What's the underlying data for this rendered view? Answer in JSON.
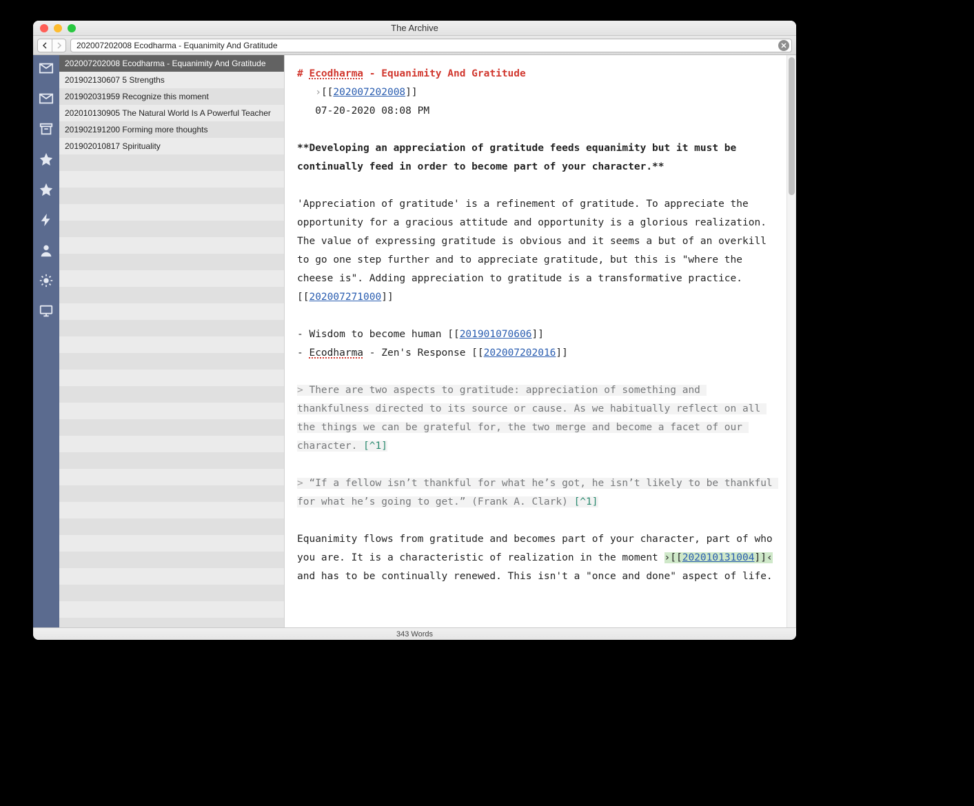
{
  "window": {
    "title": "The Archive"
  },
  "toolbar": {
    "search_value": "202007202008 Ecodharma - Equanimity And Gratitude"
  },
  "sidebar_icons": [
    {
      "name": "envelope-icon"
    },
    {
      "name": "envelope-icon"
    },
    {
      "name": "archive-box-icon"
    },
    {
      "name": "star-icon"
    },
    {
      "name": "star-icon"
    },
    {
      "name": "bolt-icon"
    },
    {
      "name": "user-icon"
    },
    {
      "name": "brightness-icon"
    },
    {
      "name": "monitor-icon"
    }
  ],
  "notes": [
    {
      "label": "202007202008 Ecodharma - Equanimity And Gratitude",
      "selected": true
    },
    {
      "label": "201902130607 5 Strengths"
    },
    {
      "label": "201902031959 Recognize this moment"
    },
    {
      "label": "202010130905 The Natural World Is A Powerful Teacher"
    },
    {
      "label": "201902191200 Forming more thoughts"
    },
    {
      "label": "201902010817 Spirituality"
    }
  ],
  "editor": {
    "hash": "#",
    "title_spell": "Ecodharma",
    "title_rest": " - Equanimity And Gratitude",
    "meta_marker": "›",
    "meta_br1": "[[",
    "meta_link": "202007202008",
    "meta_br2": "]]",
    "meta_date": "07-20-2020 08:08 PM",
    "summary": "**Developing an appreciation of gratitude feeds equanimity but it must be continually feed in order to become part of your character.**",
    "para1_a": "'Appreciation of gratitude' is a refinement of gratitude. To appreciate the opportunity for a gracious attitude and opportunity is a glorious realization. The value of expressing gratitude is obvious and it seems a but of an overkill to go one step further and to appreciate gratitude, but this is \"where the cheese is\". Adding appreciation to gratitude is a transformative practice. [[",
    "para1_link": "202007271000",
    "para1_b": "]]",
    "bullet1_a": "- Wisdom to become human [[",
    "bullet1_link": "201901070606",
    "bullet1_b": "]]",
    "bullet2_a": "- ",
    "bullet2_spell": "Ecodharma",
    "bullet2_mid": " - Zen's Response [[",
    "bullet2_link": "202007202016",
    "bullet2_b": "]]",
    "q1_marker": "> ",
    "q1_text": "There are two aspects to gratitude: appreciation of something and thankfulness directed to its source or cause. As we habitually reflect on all the things we can be grateful for, the two merge and become a facet of our character. ",
    "q1_foot": "[^1]",
    "q2_marker": "> ",
    "q2_text": "“If a fellow isn’t thankful for what he’s got, he isn’t likely to be thankful for what he’s going to get.” (Frank A. Clark) ",
    "q2_foot": "[^1]",
    "para2_a": "Equanimity flows from gratitude and becomes part of your character, part of who you are. It is a characteristic of realization in the moment ",
    "para2_hl_pre": "›[[",
    "para2_hl_link": "202010131004",
    "para2_hl_post": "]]‹",
    "para2_b": " and has to be continually renewed. This isn't a \"once and done\" aspect of life."
  },
  "status": {
    "words": "343 Words"
  }
}
